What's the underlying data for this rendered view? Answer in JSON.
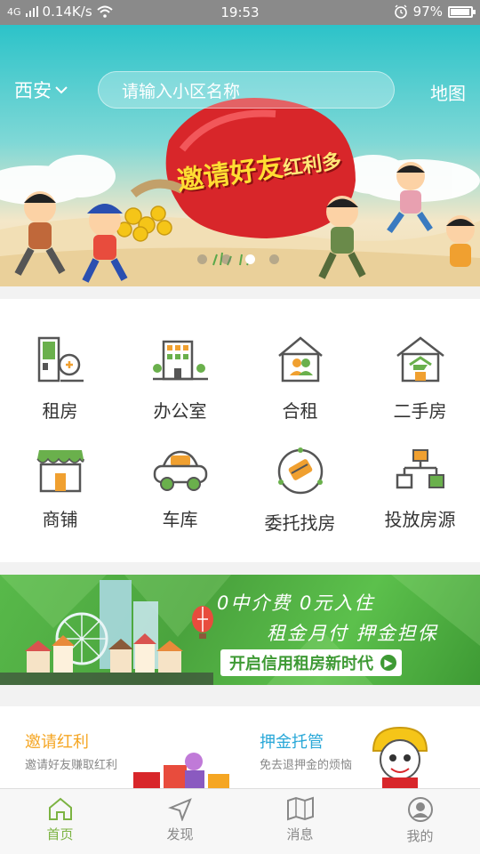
{
  "status_bar": {
    "signal": "4G",
    "speed": "0.14K/s",
    "time": "19:53",
    "battery": "97%"
  },
  "header": {
    "city": "西安",
    "search_placeholder": "请输入小区名称",
    "map_label": "地图"
  },
  "banner": {
    "headline": "邀请好友",
    "headline_small": "红利多",
    "slide_count": 4,
    "active_slide": 3
  },
  "categories": [
    {
      "label": "租房",
      "icon": "rent-icon"
    },
    {
      "label": "办公室",
      "icon": "office-icon"
    },
    {
      "label": "合租",
      "icon": "shared-rent-icon"
    },
    {
      "label": "二手房",
      "icon": "second-hand-house-icon"
    },
    {
      "label": "商铺",
      "icon": "shop-icon"
    },
    {
      "label": "车库",
      "icon": "garage-icon"
    },
    {
      "label": "委托找房",
      "icon": "entrust-icon"
    },
    {
      "label": "投放房源",
      "icon": "list-property-icon"
    }
  ],
  "ad": {
    "line1": "0中介费  0元入住",
    "line2": "租金月付  押金担保",
    "cta": "开启信用租房新时代"
  },
  "promo_cards": [
    {
      "title": "邀请红利",
      "subtitle": "邀请好友赚取红利",
      "color": "#f5a623"
    },
    {
      "title": "押金托管",
      "subtitle": "免去退押金的烦恼",
      "color": "#29a8d8"
    }
  ],
  "tabs": [
    {
      "label": "首页",
      "icon": "home-icon",
      "active": true
    },
    {
      "label": "发现",
      "icon": "discover-icon",
      "active": false
    },
    {
      "label": "消息",
      "icon": "map-message-icon",
      "active": false
    },
    {
      "label": "我的",
      "icon": "profile-icon",
      "active": false
    }
  ],
  "colors": {
    "accent": "#7cb342",
    "icon_green": "#6ab04c",
    "icon_orange": "#f0a030",
    "icon_dark": "#555555"
  }
}
